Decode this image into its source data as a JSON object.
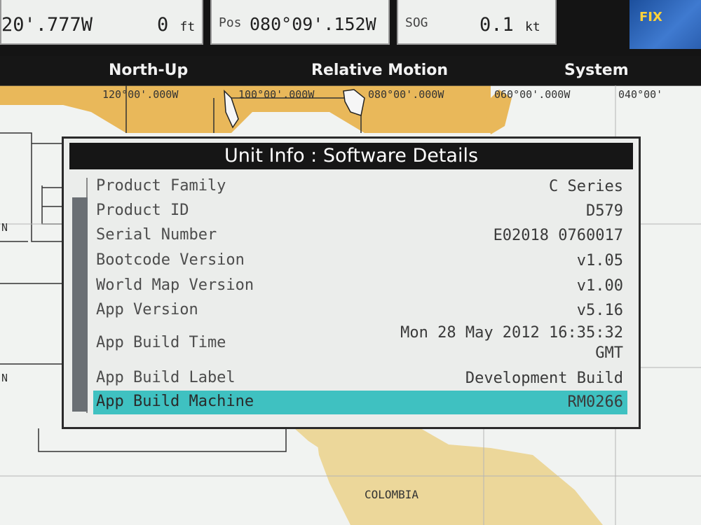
{
  "topbar": {
    "lon": "20'.777W",
    "depth_value": "0",
    "depth_unit": "ft",
    "pos_label": "Pos",
    "pos_value": "080°09'.152W",
    "sog_label": "SOG",
    "sog_value": "0.1",
    "sog_unit": "kt",
    "fix_label": "FIX"
  },
  "menu": {
    "north_up": "North-Up",
    "relative_motion": "Relative Motion",
    "system": "System"
  },
  "chart": {
    "grid_labels": [
      "120°00'.000W",
      "100°00'.000W",
      "080°00'.000W",
      "060°00'.000W",
      "040°00'"
    ],
    "country": "COLOMBIA",
    "lat_marks": [
      "N",
      "N"
    ]
  },
  "dialog": {
    "title": "Unit Info : Software Details",
    "rows": [
      {
        "label": "Product Family",
        "value": "C Series"
      },
      {
        "label": "Product ID",
        "value": "D579"
      },
      {
        "label": "Serial Number",
        "value": "E02018 0760017"
      },
      {
        "label": "Bootcode Version",
        "value": "v1.05"
      },
      {
        "label": "World Map Version",
        "value": "v1.00"
      },
      {
        "label": "App Version",
        "value": "v5.16"
      },
      {
        "label": "App Build Time",
        "value": "Mon 28 May 2012  16:35:32",
        "value2": "GMT"
      },
      {
        "label": "App Build Label",
        "value": "Development Build"
      },
      {
        "label": "App Build Machine",
        "value": "RM0266"
      }
    ]
  },
  "colors": {
    "land": "#e9b85a",
    "sea": "#f1f3f1",
    "highlight": "#3fc1c1",
    "header_bg": "#161616"
  }
}
